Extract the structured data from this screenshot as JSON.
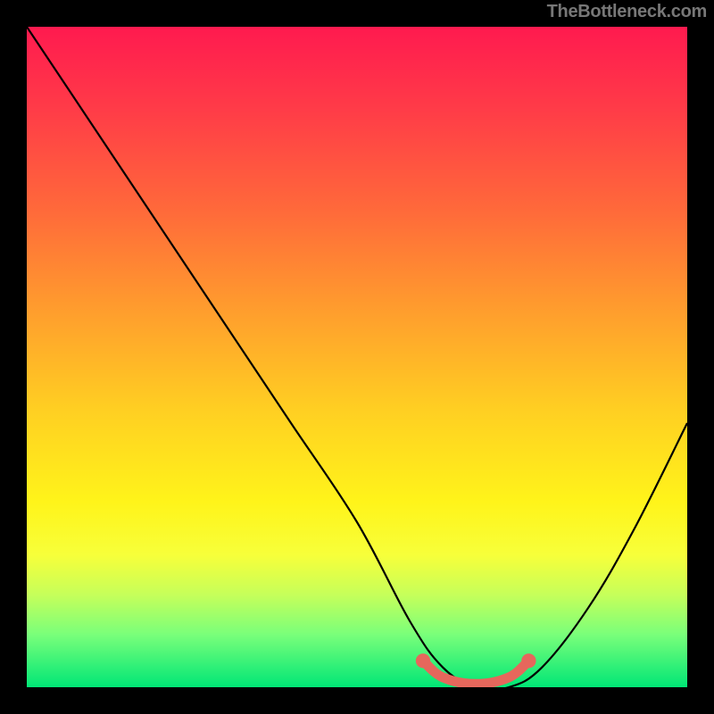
{
  "attribution": "TheBottleneck.com",
  "chart_data": {
    "type": "line",
    "title": "",
    "xlabel": "",
    "ylabel": "",
    "xlim": [
      0,
      100
    ],
    "ylim": [
      0,
      100
    ],
    "background_gradient": {
      "top": "#ff1a4f",
      "bottom": "#00e676"
    },
    "series": [
      {
        "name": "bottleneck-curve",
        "color": "#000000",
        "x": [
          0,
          10,
          20,
          30,
          40,
          50,
          58,
          63,
          68,
          73,
          78,
          85,
          92,
          100
        ],
        "y": [
          100,
          85,
          70,
          55,
          40,
          25,
          10,
          3,
          0,
          0,
          3,
          12,
          24,
          40
        ]
      }
    ],
    "highlight": {
      "name": "optimal-range",
      "color": "#e6675c",
      "x": [
        60,
        63,
        68,
        73,
        76
      ],
      "y": [
        4,
        1.5,
        0.5,
        1.5,
        4
      ]
    }
  }
}
